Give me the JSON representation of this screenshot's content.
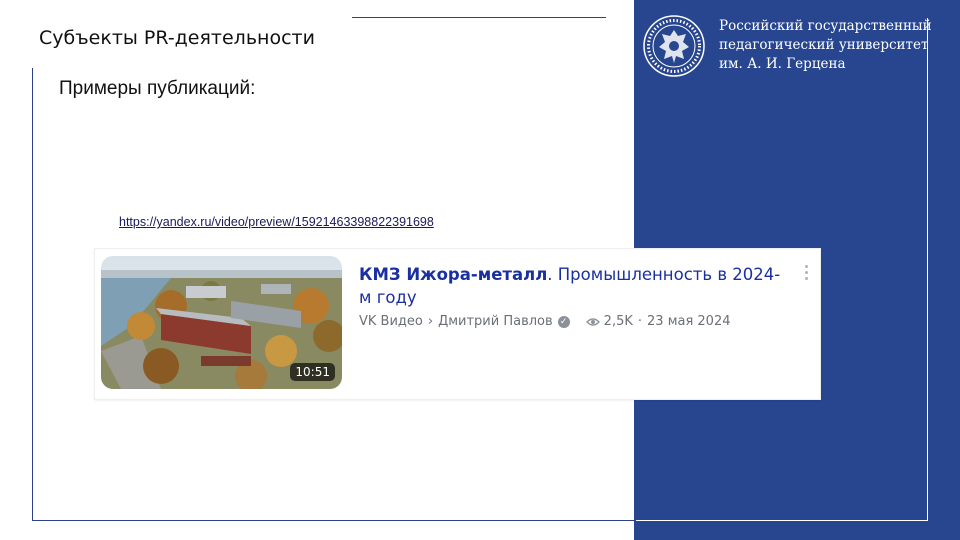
{
  "slide": {
    "title": "Субъекты PR-деятельности",
    "subtitle": "Примеры публикаций:",
    "link": "https://yandex.ru/video/preview/15921463398822391698"
  },
  "university": {
    "line1": "Российский государственный",
    "line2": "педагогический университет",
    "line3": "им. А. И. Герцена",
    "emblem_icon": "university-seal-icon"
  },
  "video": {
    "title_bold": "КМЗ Ижора-металл",
    "title_rest": ". Промышленность в 2024-м году",
    "platform": "VK Видео",
    "separator": "›",
    "author": "Дмитрий Павлов",
    "views": "2,5K",
    "dot": "·",
    "date": "23 мая 2024",
    "duration": "10:51"
  },
  "colors": {
    "panel_blue": "#27468f",
    "link_title_blue": "#1a2fa0",
    "frame_line": "#2b3f8a"
  }
}
